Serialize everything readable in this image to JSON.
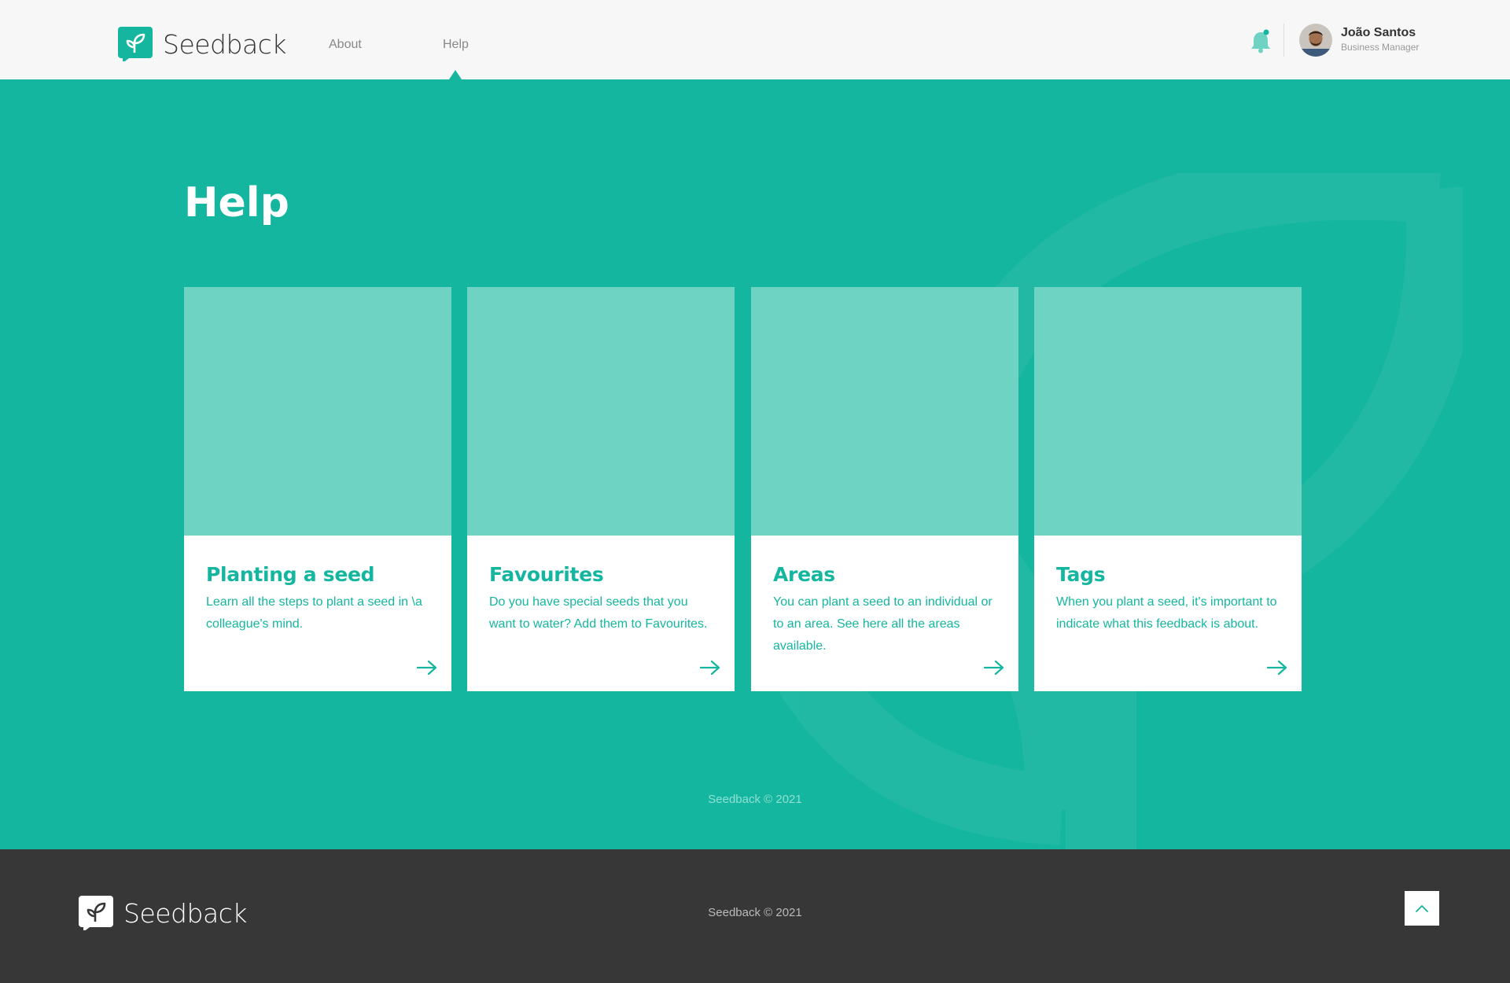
{
  "header": {
    "brand": "Seedback",
    "nav": [
      {
        "label": "About"
      },
      {
        "label": "Help",
        "active": true
      }
    ],
    "user": {
      "name": "João Santos",
      "role": "Business Manager"
    }
  },
  "main": {
    "title": "Help",
    "cards": [
      {
        "title": "Planting a seed",
        "description": "Learn all the steps to plant a seed in \\a colleague's mind."
      },
      {
        "title": "Favourites",
        "description": "Do you have special seeds that you want to water? Add them to Favourites."
      },
      {
        "title": "Areas",
        "description": "You can plant a seed to an individual or to an area. See here all the areas available."
      },
      {
        "title": "Tags",
        "description": "When you plant a seed, it's important to indicate what this feedback is about."
      }
    ],
    "copyright": "Seedback © 2021"
  },
  "footer": {
    "brand": "Seedback",
    "copyright": "Seedback © 2021",
    "back_to_top_icon": "chevron-up-icon"
  },
  "colors": {
    "accent": "#15b69f",
    "card_image": "#6fd3c3",
    "footer_bg": "#373737",
    "header_bg": "#f7f7f7"
  }
}
